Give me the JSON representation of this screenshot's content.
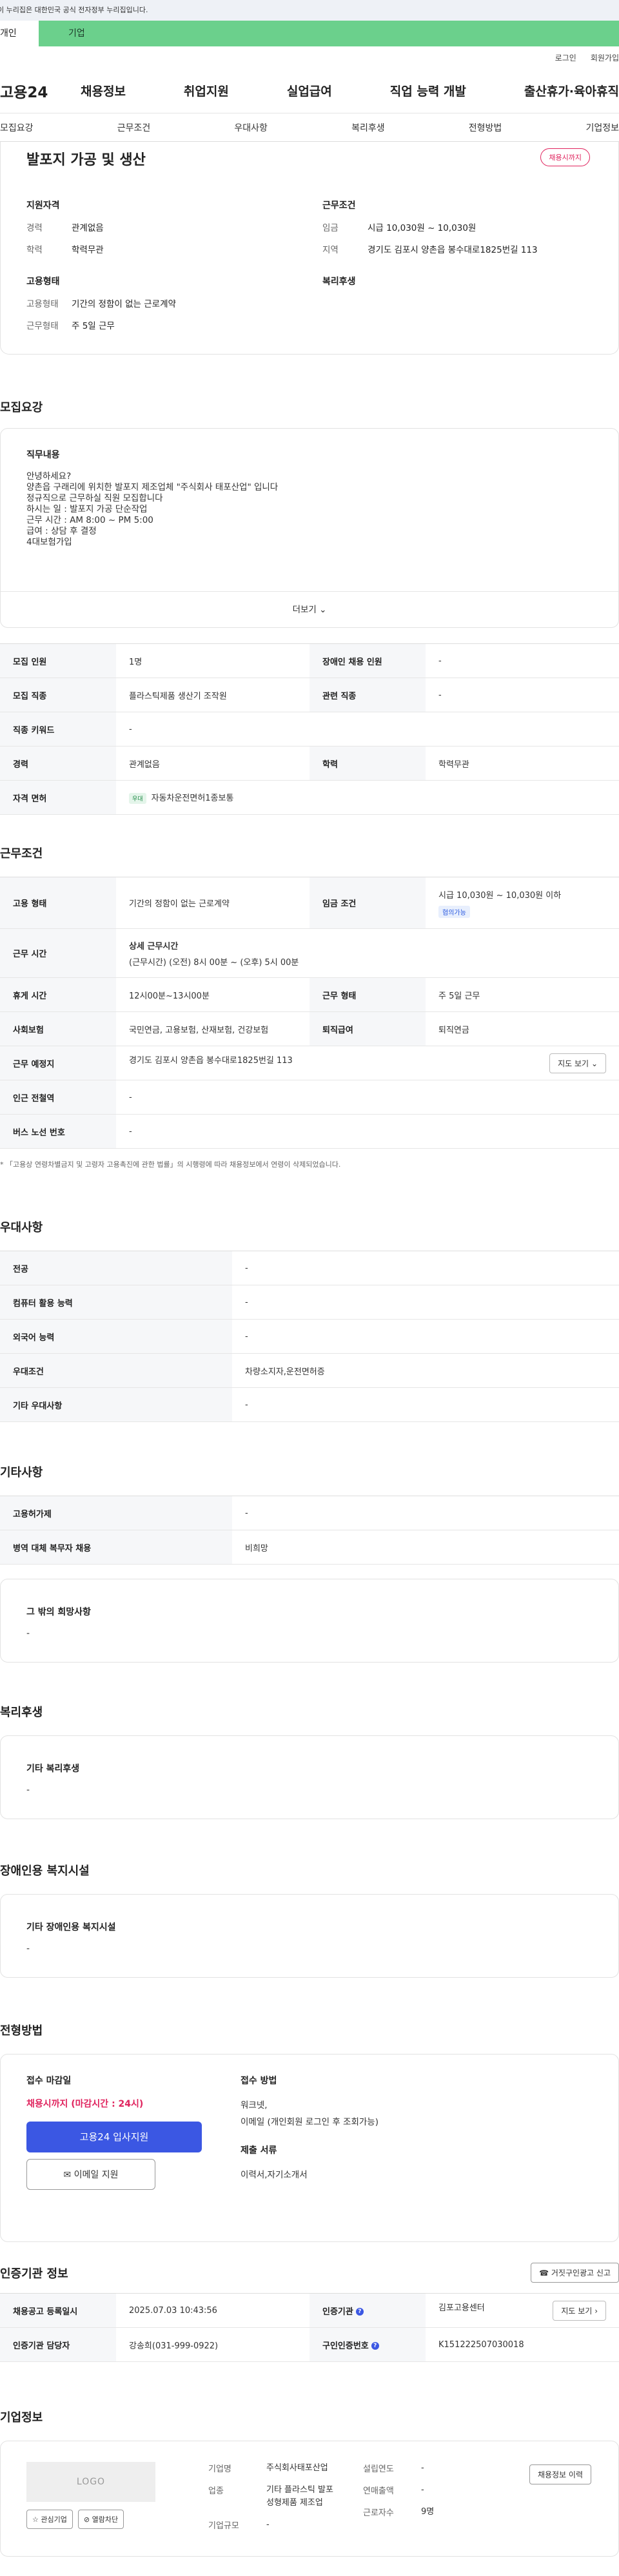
{
  "gov_banner": "이 누리집은 대한민국 공식 전자정부 누리집입니다.",
  "user_tabs": {
    "individual": "개인",
    "corporate": "기업"
  },
  "util_links": {
    "login": "로그인",
    "join": "회원가입"
  },
  "logo": "고용24",
  "gnb": [
    "채용정보",
    "취업지원",
    "실업급여",
    "직업 능력 개발",
    "출산휴가·육아휴직"
  ],
  "anchor_nav": [
    "모집요강",
    "근무조건",
    "우대사항",
    "복리후생",
    "전형방법",
    "기업정보"
  ],
  "summary": {
    "title": "발포지 가공 및 생산",
    "badge": "채용시까지",
    "qual_heading": "지원자격",
    "career_label": "경력",
    "career_value": "관계없음",
    "edu_label": "학력",
    "edu_value": "학력무관",
    "cond_heading": "근무조건",
    "wage_label": "임금",
    "wage_value": "시급 10,030원 ~ 10,030원",
    "area_label": "지역",
    "area_value": "경기도 김포시 양촌읍 봉수대로1825번길 113",
    "emp_heading": "고용형태",
    "emp_type_label": "고용형태",
    "emp_type_value": "기간의 정함이 없는 근로계약",
    "work_type_label": "근무형태",
    "work_type_value": "주 5일 근무",
    "welfare_heading": "복리후생"
  },
  "recruit": {
    "title": "모집요강",
    "duty_heading": "직무내용",
    "duty_lines": [
      "안녕하세요?",
      "양촌읍 구래리에 위치한 발포지 제조업체 \"주식회사 태포산업\" 입니다",
      "정규직으로 근무하실 직원 모집합니다",
      "",
      "하시는 일 : 발포지 가공 단순작업",
      "근무 시간 : AM 8:00 ~ PM 5:00",
      "급여 : 상담 후 결정",
      "4대보험가입"
    ],
    "more": "더보기",
    "rows": {
      "headcount_label": "모집 인원",
      "headcount": "1명",
      "disabled_label": "장애인 채용 인원",
      "disabled": "-",
      "job_label": "모집 직종",
      "job": "플라스틱제품 생산기 조작원",
      "related_label": "관련 직종",
      "related": "-",
      "keyword_label": "직종 키워드",
      "keyword": "-",
      "career_label": "경력",
      "career": "관계없음",
      "edu_label": "학력",
      "edu": "학력무관",
      "license_label": "자격 면허",
      "license_badge": "우대",
      "license": "자동차운전면허1종보통"
    }
  },
  "work": {
    "title": "근무조건",
    "emp_type_label": "고용 형태",
    "emp_type": "기간의 정함이 없는 근로계약",
    "wage_label": "임금 조건",
    "wage": "시급 10,030원 ~ 10,030원 이하",
    "wage_badge": "협의가능",
    "hours_label": "근무 시간",
    "hours_detail_title": "상세 근무시간",
    "hours_detail": "(근무시간) (오전) 8시 00분 ~ (오후) 5시 00분",
    "break_label": "휴게 시간",
    "break": "12시00분~13시00분",
    "work_type_label": "근무 형태",
    "work_type": "주 5일 근무",
    "insurance_label": "사회보험",
    "insurance": "국민연금, 고용보험, 산재보험, 건강보험",
    "retire_label": "퇴직급여",
    "retire": "퇴직연금",
    "place_label": "근무 예정지",
    "place": "경기도 김포시 양촌읍 봉수대로1825번길 113",
    "map_btn": "지도 보기",
    "subway_label": "인근 전철역",
    "subway": "-",
    "bus_label": "버스 노선 번호",
    "bus": "-",
    "note": "* 「고용상 연령차별금지 및 고령자 고용촉진에 관한 법률」의 시행령에 따라 채용정보에서 연령이 삭제되었습니다."
  },
  "pref": {
    "title": "우대사항",
    "major_label": "전공",
    "major": "-",
    "pc_label": "컴퓨터 활용 능력",
    "pc": "-",
    "lang_label": "외국어 능력",
    "lang": "-",
    "cond_label": "우대조건",
    "cond": "차량소지자,운전면허증",
    "other_label": "기타 우대사항",
    "other": "-"
  },
  "etc": {
    "title": "기타사항",
    "permit_label": "고용허가제",
    "permit": "-",
    "military_label": "병역 대체 복무자 채용",
    "military": "비희망",
    "hope_heading": "그 밖의 희망사항",
    "hope": "-"
  },
  "welfare": {
    "title": "복리후생",
    "heading": "기타 복리후생",
    "value": "-"
  },
  "disabled_fac": {
    "title": "장애인용 복지시설",
    "heading": "기타 장애인용 복지시설",
    "value": "-"
  },
  "apply": {
    "title": "전형방법",
    "deadline_heading": "접수 마감일",
    "deadline": "채용시까지 (마감시간 : 24시)",
    "apply_btn": "고용24 입사지원",
    "email_btn": "이메일 지원",
    "method_heading": "접수 방법",
    "method1": "워크넷,",
    "method2": "이메일 (개인회원 로그인 후 조회가능)",
    "docs_heading": "제출 서류",
    "docs": "이력서,자기소개서"
  },
  "cert": {
    "title": "인증기관 정보",
    "report_btn": "거짓구인광고 신고",
    "reg_date_label": "채용공고 등록일시",
    "reg_date": "2025.07.03 10:43:56",
    "agency_label": "인증기관",
    "agency": "김포고용센터",
    "map_btn": "지도 보기",
    "manager_label": "인증기관 담당자",
    "manager": "강송희(031-999-0922)",
    "cert_no_label": "구인인증번호",
    "cert_no": "K151222507030018"
  },
  "company": {
    "title": "기업정보",
    "logo_ph": "LOGO",
    "fav_btn": "관심기업",
    "block_btn": "열람차단",
    "name_label": "기업명",
    "name": "주식회사태포산업",
    "industry_label": "업종",
    "industry": "기타 플라스틱 발포 성형제품 제조업",
    "scale_label": "기업규모",
    "scale": "-",
    "year_label": "설립연도",
    "year": "-",
    "sales_label": "연매출액",
    "sales": "-",
    "staff_label": "근로자수",
    "staff": "9명",
    "history_btn": "채용정보 이력"
  }
}
